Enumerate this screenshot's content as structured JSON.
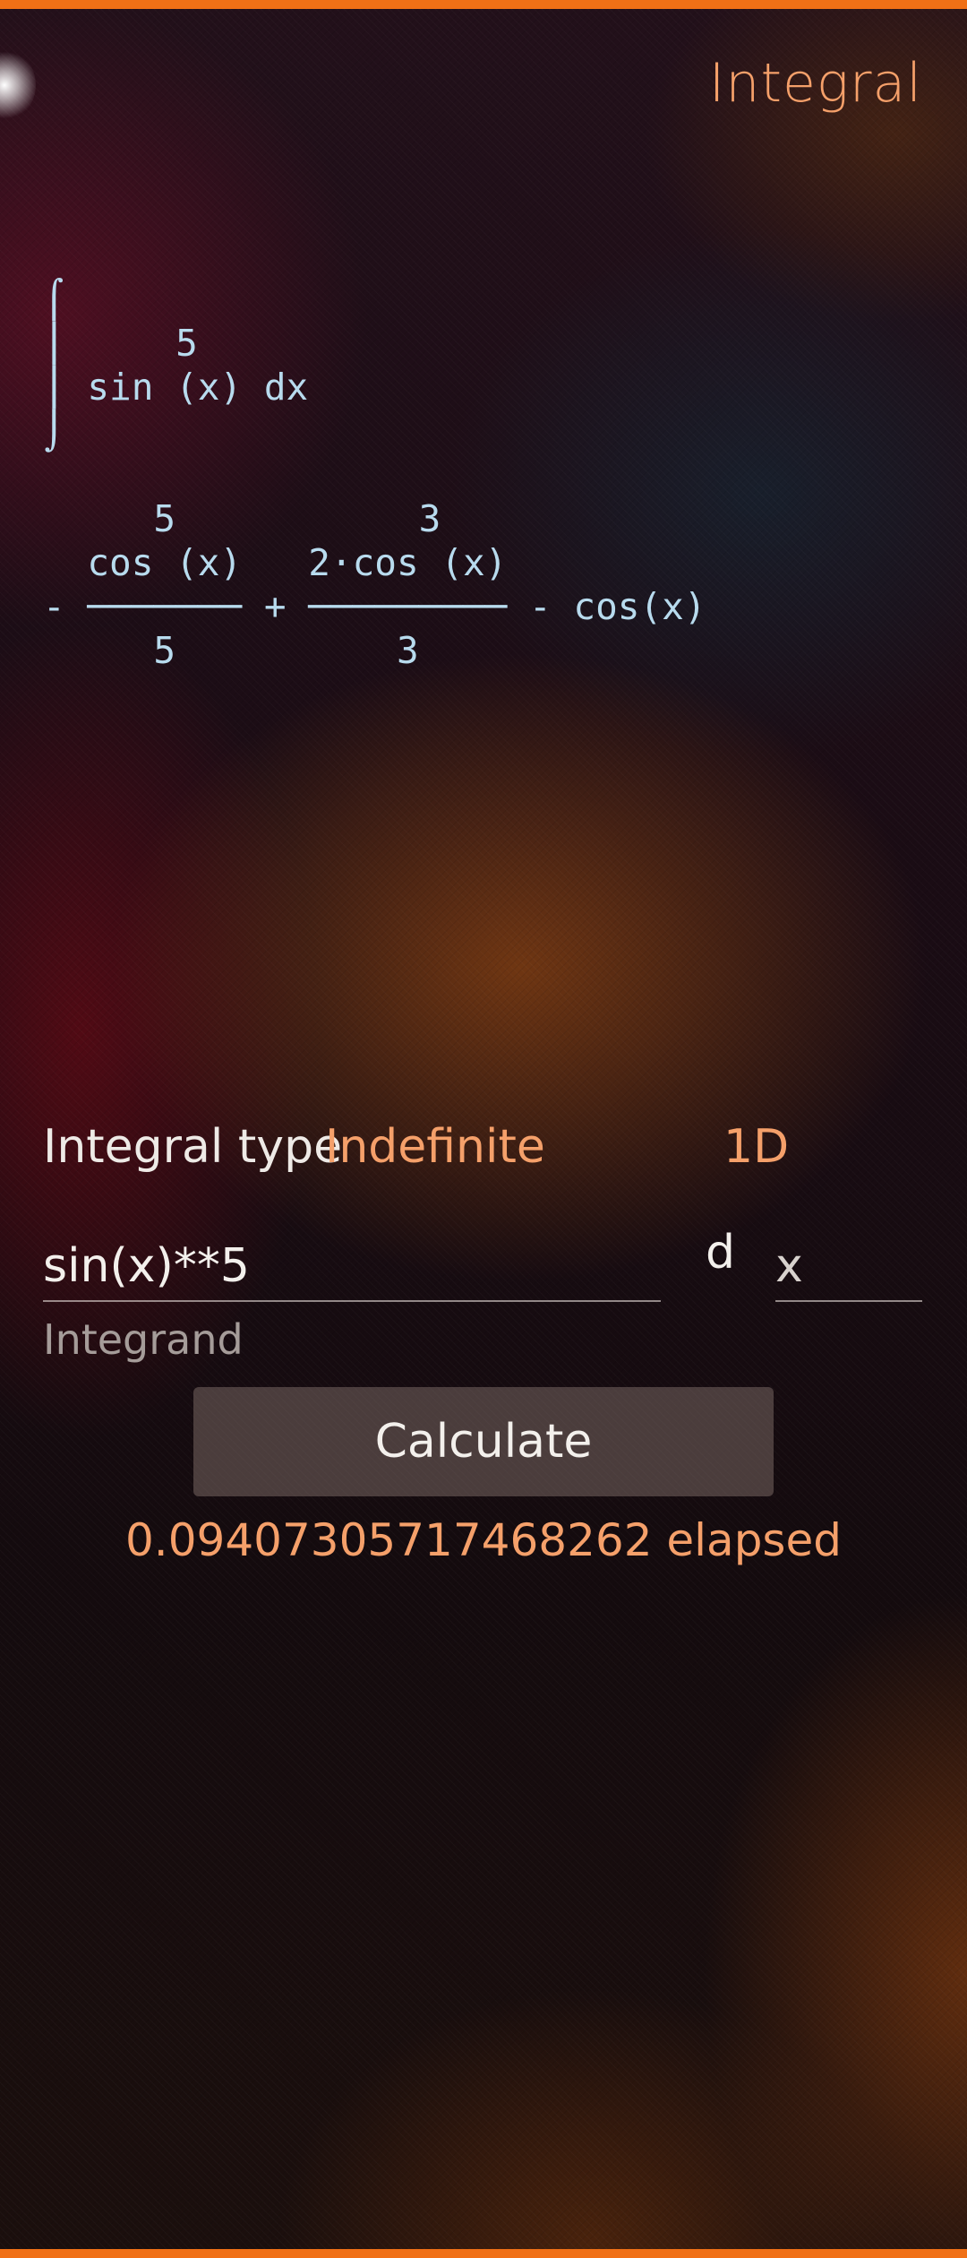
{
  "header": {
    "title": "Integral"
  },
  "expression": {
    "integral_pretty": "⌠\n⎮     5\n⎮ sin (x) dx\n⌡",
    "result_pretty": "     5           3\n  cos (x)   2⋅cos (x)\n- ─────── + ───────── - cos(x)\n     5          3"
  },
  "form": {
    "integral_type_label": "Integral type",
    "integral_type_value": "Indefinite",
    "dimension_value": "1D",
    "integrand_value": "sin(x)**5",
    "integrand_label": "Integrand",
    "differential_label": "d",
    "variable_value": "x",
    "calculate_label": "Calculate"
  },
  "status": {
    "elapsed_text": "0.09407305717468262 elapsed"
  },
  "colors": {
    "accent": "#f5a06a",
    "edge": "#f07016",
    "math_text": "#b8dbee"
  }
}
